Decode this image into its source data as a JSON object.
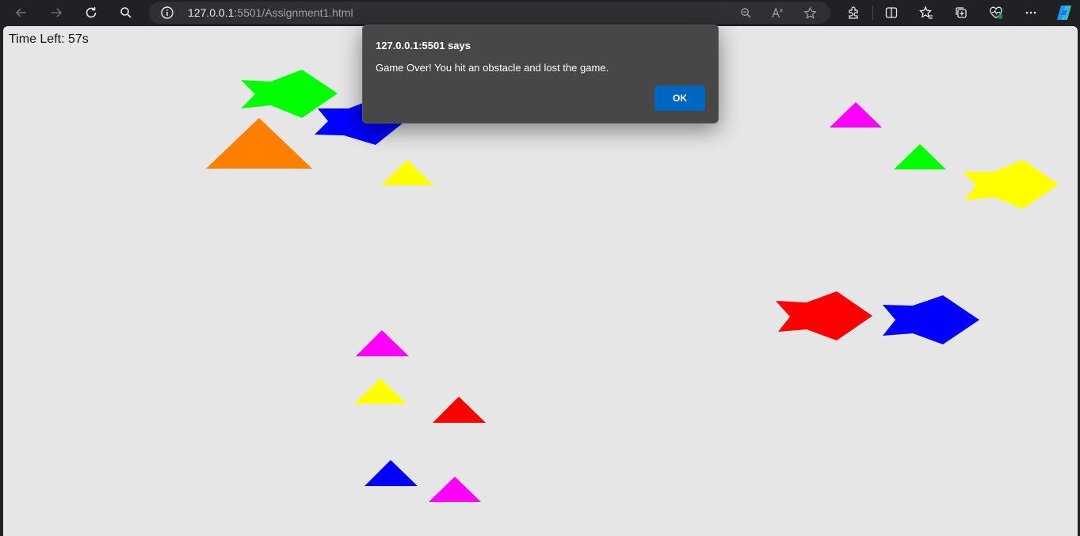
{
  "browser": {
    "url_host": "127.0.0.1",
    "url_rest": ":5501/Assignment1.html",
    "nav_icons": [
      "back-arrow-icon",
      "forward-arrow-icon",
      "reload-icon",
      "search-icon"
    ],
    "omnibox_icons": [
      "zoom-out-icon",
      "read-aloud-icon",
      "favorite-star-icon"
    ],
    "toolbar_icons": [
      "extensions-icon",
      "split-screen-icon",
      "favorites-icon",
      "collections-icon",
      "browser-essentials-icon",
      "more-menu-icon",
      "copilot-icon"
    ]
  },
  "game": {
    "timer_text": "Time Left: 57s",
    "background": "#e6e6e6",
    "shapes": [
      {
        "kind": "fish",
        "color": "#00ff00"
      },
      {
        "kind": "fish",
        "color": "#0000ff"
      },
      {
        "kind": "triangle",
        "color": "#ff8000"
      },
      {
        "kind": "triangle",
        "color": "#ffff00"
      },
      {
        "kind": "triangle",
        "color": "#ff00ff"
      },
      {
        "kind": "triangle",
        "color": "#00ff00"
      },
      {
        "kind": "fish",
        "color": "#ffff00"
      },
      {
        "kind": "fish",
        "color": "#ff0000"
      },
      {
        "kind": "fish",
        "color": "#0000ff"
      },
      {
        "kind": "triangle",
        "color": "#ff00ff"
      },
      {
        "kind": "triangle",
        "color": "#ffff00"
      },
      {
        "kind": "triangle",
        "color": "#ff0000"
      },
      {
        "kind": "triangle",
        "color": "#0000ff"
      },
      {
        "kind": "triangle",
        "color": "#ff00ff"
      }
    ]
  },
  "alert": {
    "title": "127.0.0.1:5501 says",
    "message": "Game Over! You hit an obstacle and lost the game.",
    "ok_label": "OK",
    "ok_color": "#0067c0"
  }
}
